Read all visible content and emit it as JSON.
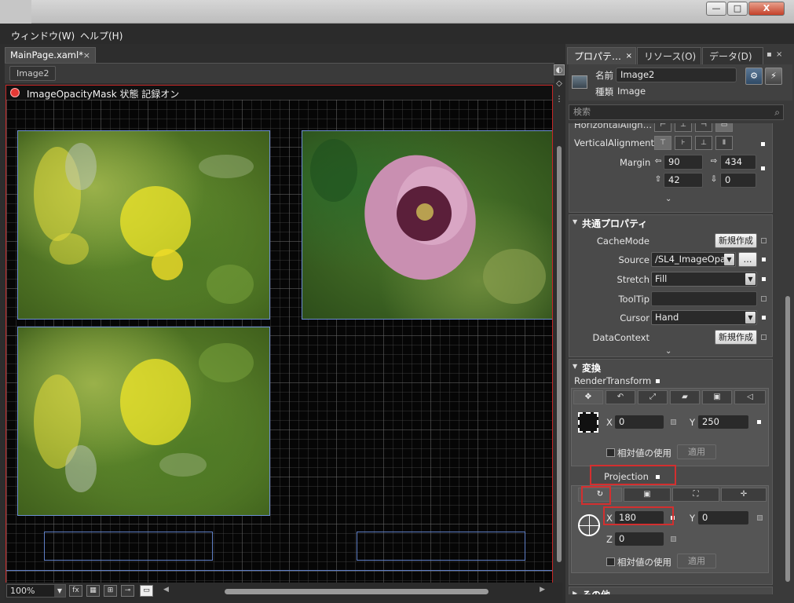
{
  "window": {
    "minimize_label": "—",
    "maximize_label": "□",
    "close_label": "X"
  },
  "menu": {
    "items": [
      "ウィンドウ(W)",
      "ヘルプ(H)"
    ]
  },
  "document": {
    "tab_label": "MainPage.xaml*",
    "tab_close": "×",
    "breadcrumb": "Image2",
    "recording_text": "ImageOpacityMask 状態 記録オン",
    "zoom": "100%",
    "zoom_arrow": "▼"
  },
  "panel": {
    "tabs": [
      {
        "label": "プロパテ…",
        "close": "×"
      },
      {
        "label": "リソース(O)"
      },
      {
        "label": "データ(D)"
      }
    ],
    "pin": "▪",
    "close": "×",
    "name_label": "名前",
    "name_value": "Image2",
    "type_label": "種類",
    "type_value": "Image",
    "search_placeholder": "検索",
    "search_icon": "⌕",
    "layout": {
      "horizontal_alignment_label": "HorizontalAlign…",
      "vertical_alignment_label": "VerticalAlignment",
      "margin_label": "Margin",
      "margin_left": "90",
      "margin_right": "434",
      "margin_top": "42",
      "margin_bottom": "0",
      "expand": "⌄"
    },
    "common": {
      "header": "共通プロパティ",
      "expander": "▼",
      "cache_mode_label": "CacheMode",
      "new_button": "新規作成",
      "source_label": "Source",
      "source_value": "/SL4_ImageOpa",
      "browse_label": "…",
      "stretch_label": "Stretch",
      "stretch_value": "Fill",
      "tooltip_label": "ToolTip",
      "tooltip_value": "",
      "cursor_label": "Cursor",
      "cursor_value": "Hand",
      "datacontext_label": "DataContext",
      "datacontext_button": "新規作成",
      "expand": "⌄",
      "dropdown_arrow": "▼"
    },
    "transform": {
      "header": "変換",
      "expander": "▼",
      "render_transform_label": "RenderTransform",
      "tabs": [
        "✥",
        "↶",
        "⤢",
        "▰",
        "▣",
        "◁"
      ],
      "x_label": "X",
      "x_value": "0",
      "y_label": "Y",
      "y_value": "250",
      "relative_label": "相対値の使用",
      "apply_label": "適用",
      "projection_label": "Projection",
      "projection_tabs": [
        "↻",
        "▣",
        "⛶",
        "✛"
      ],
      "proj_x_label": "X",
      "proj_x_value": "180",
      "proj_y_label": "Y",
      "proj_y_value": "0",
      "proj_z_label": "Z",
      "proj_z_value": "0",
      "proj_relative_label": "相対値の使用",
      "proj_apply_label": "適用"
    },
    "other": {
      "header": "その他",
      "expander": "▶"
    }
  },
  "colors": {
    "record_border": "#c62828",
    "selection_blue": "#6d8fd4",
    "highlight_red": "#d32f2f"
  }
}
